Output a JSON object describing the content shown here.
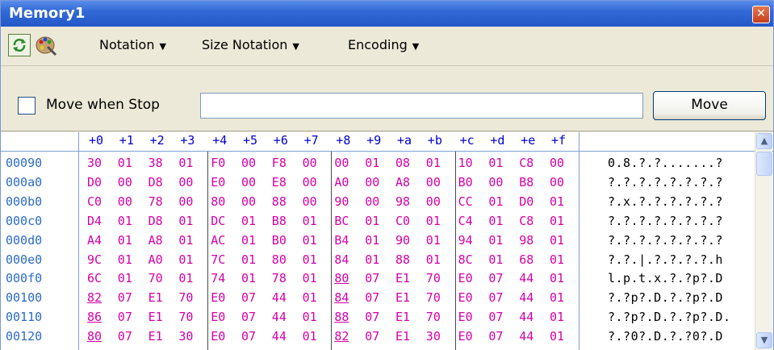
{
  "window": {
    "title": "Memory1",
    "close_symbol": "✕"
  },
  "toolbar": {
    "menus": [
      {
        "label": "Notation",
        "arrow": "▼"
      },
      {
        "label": "Size Notation",
        "arrow": "▼"
      },
      {
        "label": "Encoding",
        "arrow": "▼"
      }
    ]
  },
  "options": {
    "move_when_stop_label": "Move when Stop",
    "move_when_stop_checked": false,
    "address_input_value": "",
    "move_button_label": "Move"
  },
  "grid": {
    "column_headers": [
      "+0",
      "+1",
      "+2",
      "+3",
      "+4",
      "+5",
      "+6",
      "+7",
      "+8",
      "+9",
      "+a",
      "+b",
      "+c",
      "+d",
      "+e",
      "+f"
    ],
    "rows": [
      {
        "address": "00090",
        "bytes": [
          "30",
          "01",
          "38",
          "01",
          "F0",
          "00",
          "F8",
          "00",
          "00",
          "01",
          "08",
          "01",
          "10",
          "01",
          "C8",
          "00"
        ],
        "ascii": "0.8.?.?.......?"
      },
      {
        "address": "000a0",
        "bytes": [
          "D0",
          "00",
          "D8",
          "00",
          "E0",
          "00",
          "E8",
          "00",
          "A0",
          "00",
          "A8",
          "00",
          "B0",
          "00",
          "B8",
          "00"
        ],
        "ascii": "?.?.?.?.?.?.?.?"
      },
      {
        "address": "000b0",
        "bytes": [
          "C0",
          "00",
          "78",
          "00",
          "80",
          "00",
          "88",
          "00",
          "90",
          "00",
          "98",
          "00",
          "CC",
          "01",
          "D0",
          "01"
        ],
        "ascii": "?.x.?.?.?.?.?.?"
      },
      {
        "address": "000c0",
        "bytes": [
          "D4",
          "01",
          "D8",
          "01",
          "DC",
          "01",
          "B8",
          "01",
          "BC",
          "01",
          "C0",
          "01",
          "C4",
          "01",
          "C8",
          "01"
        ],
        "ascii": "?.?.?.?.?.?.?.?"
      },
      {
        "address": "000d0",
        "bytes": [
          "A4",
          "01",
          "A8",
          "01",
          "AC",
          "01",
          "B0",
          "01",
          "B4",
          "01",
          "90",
          "01",
          "94",
          "01",
          "98",
          "01"
        ],
        "ascii": "?.?.?.?.?.?.?.?"
      },
      {
        "address": "000e0",
        "bytes": [
          "9C",
          "01",
          "A0",
          "01",
          "7C",
          "01",
          "80",
          "01",
          "84",
          "01",
          "88",
          "01",
          "8C",
          "01",
          "68",
          "01"
        ],
        "ascii": "?.?.|.?.?.?.?.h"
      },
      {
        "address": "000f0",
        "bytes": [
          "6C",
          "01",
          "70",
          "01",
          "74",
          "01",
          "78",
          "01",
          "80",
          "07",
          "E1",
          "70",
          "E0",
          "07",
          "44",
          "01"
        ],
        "ascii": "l.p.t.x.?.?p?.D"
      },
      {
        "address": "00100",
        "bytes": [
          "82",
          "07",
          "E1",
          "70",
          "E0",
          "07",
          "44",
          "01",
          "84",
          "07",
          "E1",
          "70",
          "E0",
          "07",
          "44",
          "01"
        ],
        "ascii": "?.?p?.D.?.?p?.D"
      },
      {
        "address": "00110",
        "bytes": [
          "86",
          "07",
          "E1",
          "70",
          "E0",
          "07",
          "44",
          "01",
          "88",
          "07",
          "E1",
          "70",
          "E0",
          "07",
          "44",
          "01"
        ],
        "ascii": "?.?p?.D.?.?p?.D."
      },
      {
        "address": "00120",
        "bytes": [
          "80",
          "07",
          "E1",
          "30",
          "E0",
          "07",
          "44",
          "01",
          "82",
          "07",
          "E1",
          "30",
          "E0",
          "07",
          "44",
          "01"
        ],
        "ascii": "?.?0?.D.?.?0?.D"
      }
    ],
    "underlined": [
      [
        6,
        8
      ],
      [
        7,
        0
      ],
      [
        7,
        8
      ],
      [
        8,
        0
      ],
      [
        8,
        8
      ],
      [
        9,
        0
      ],
      [
        9,
        8
      ]
    ]
  },
  "colors": {
    "address": "#2b6cc4",
    "bytes": "#d400a8",
    "header": "#0000cc",
    "titlebar": "#3169d6"
  },
  "icons": {
    "refresh": "refresh-icon",
    "palette": "palette-icon",
    "scroll_up": "▲",
    "scroll_down": "▼"
  }
}
